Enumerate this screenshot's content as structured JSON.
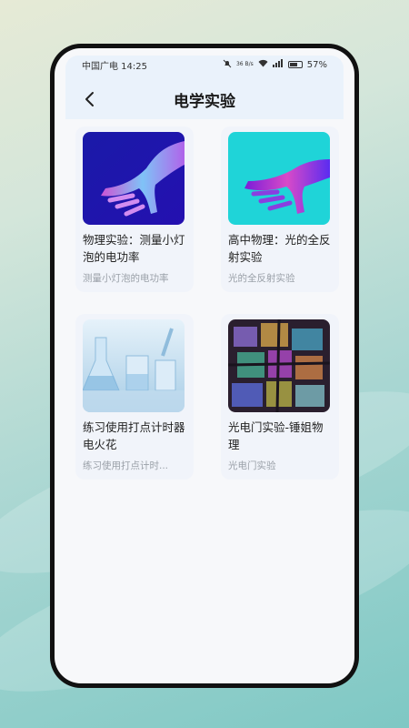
{
  "status": {
    "carrier_time": "中国广电 14:25",
    "network_speed": "36 B/s",
    "battery": "57%"
  },
  "nav": {
    "title": "电学实验"
  },
  "cards": [
    {
      "title": "物理实验：测量小灯泡的电功率",
      "subtitle": "测量小灯泡的电功率"
    },
    {
      "title": "高中物理：光的全反射实验",
      "subtitle": "光的全反射实验"
    },
    {
      "title": "练习使用打点计时器电火花",
      "subtitle": "练习使用打点计时..."
    },
    {
      "title": "光电门实验-锤姐物理",
      "subtitle": "光电门实验"
    }
  ],
  "colors": {
    "accent_bg": "#eaf2fb",
    "card_bg": "#f1f4fa"
  }
}
